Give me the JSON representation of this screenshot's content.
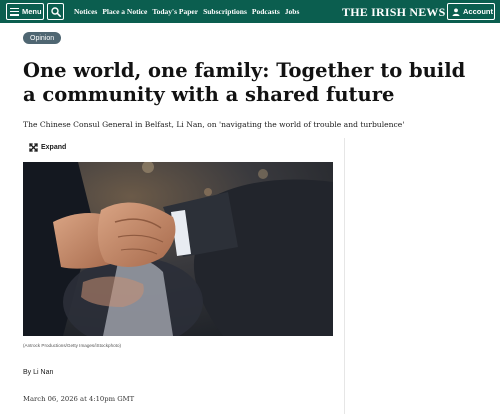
{
  "header": {
    "menu_label": "Menu",
    "nav": [
      "Notices",
      "Place a Notice",
      "Today's Paper",
      "Subscriptions",
      "Podcasts",
      "Jobs"
    ],
    "brand": "THE IRISH NEWS",
    "account_label": "Account",
    "bg_color": "#0b5e4f"
  },
  "article": {
    "category": "Opinion",
    "headline": "One world, one family: Together to build a community with a shared future",
    "standfirst": "The Chinese Consul General in Belfast, Li Nan, on 'navigating the world of trouble and turbulence'",
    "expand_label": "Expand",
    "image_caption": "(Antrock Productions/Getty Images/iStockphoto)",
    "byline_prefix": "By",
    "author": "Li Nan",
    "date": "March 06, 2026 at 4:10pm GMT"
  }
}
